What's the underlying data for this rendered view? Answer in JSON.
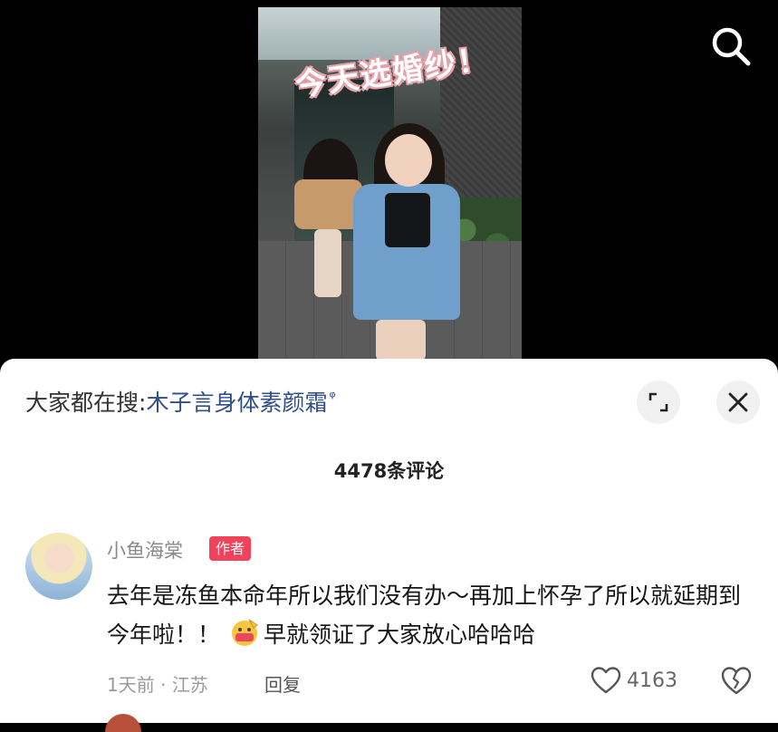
{
  "video": {
    "overlay_title": "今天选婚纱！"
  },
  "icons": {
    "top_search": "search-icon",
    "expand": "expand-icon",
    "close": "close-icon",
    "like": "heart-outline-icon",
    "dislike": "broken-heart-icon",
    "emoji": "salute-emoji"
  },
  "hot_search": {
    "prefix": "大家都在搜:",
    "term": "木子言身体素颜霜",
    "suffix_icon": "ᵠ"
  },
  "comments": {
    "count_label": "4478条评论",
    "items": [
      {
        "username": "小鱼海棠",
        "tag": "作者",
        "text_part1": "去年是冻鱼本命年所以我们没有办～再加上怀孕了所以就延期到今年啦！！",
        "text_part2": "早就领证了大家放心哈哈哈",
        "time_location": "1天前 · 江苏",
        "reply_label": "回复",
        "likes": "4163"
      }
    ]
  },
  "colors": {
    "author_tag_bg": "#f1425b",
    "hot_term": "#2f4f86"
  }
}
